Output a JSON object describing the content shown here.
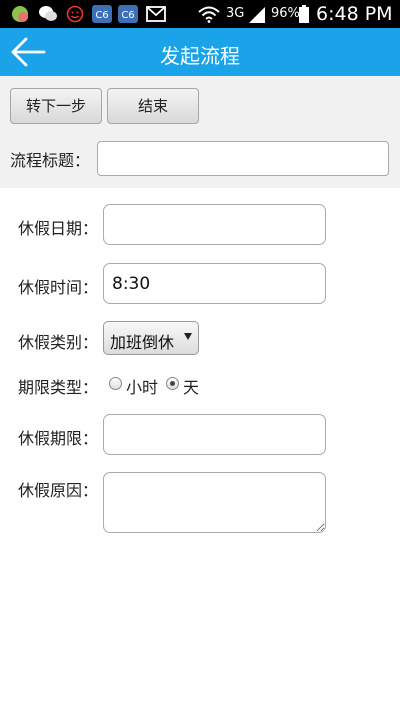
{
  "status_bar": {
    "network": "3G",
    "battery": "96%",
    "time": "6:48 PM"
  },
  "header": {
    "title": "发起流程"
  },
  "toolbar": {
    "next_step": "转下一步",
    "end": "结束"
  },
  "flow_title": {
    "label": "流程标题：",
    "value": ""
  },
  "form": {
    "leave_date": {
      "label": "休假日期：",
      "value": ""
    },
    "leave_time": {
      "label": "休假时间：",
      "value": "8:30"
    },
    "leave_type": {
      "label": "休假类别：",
      "selected": "加班倒休"
    },
    "period_type": {
      "label": "期限类型：",
      "options": [
        "小时",
        "天"
      ],
      "selected": "天"
    },
    "leave_period": {
      "label": "休假期限：",
      "value": ""
    },
    "leave_reason": {
      "label": "休假原因：",
      "value": ""
    }
  },
  "colors": {
    "accent": "#1aa3e8",
    "status_bar": "#000000",
    "toolbar_bg": "#f1f1f1"
  }
}
